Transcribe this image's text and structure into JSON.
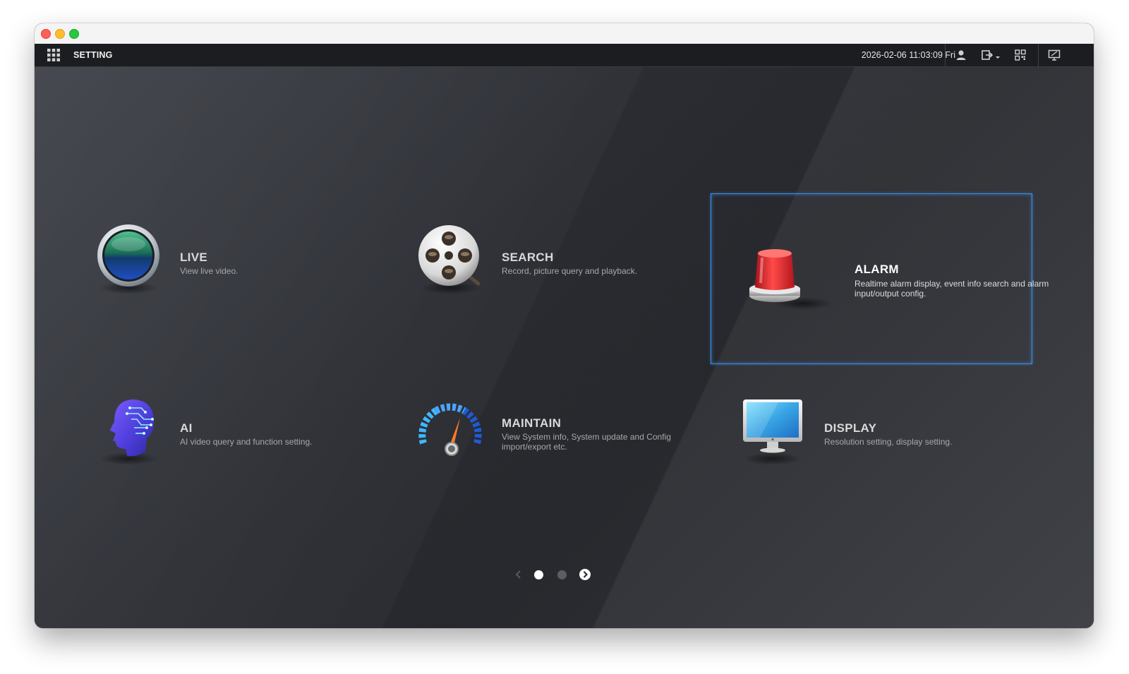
{
  "topbar": {
    "title": "SETTING",
    "datetime": "2026-02-06 11:03:09 Fri"
  },
  "tiles": [
    {
      "title": "LIVE",
      "desc": "View live video.",
      "icon": "live-lens-icon"
    },
    {
      "title": "SEARCH",
      "desc": "Record, picture query and playback.",
      "icon": "film-reel-search-icon"
    },
    {
      "title": "ALARM",
      "desc": "Realtime alarm display, event info search and alarm input/output config.",
      "icon": "alarm-siren-icon",
      "selected": true
    },
    {
      "title": "AI",
      "desc": "AI video query and function setting.",
      "icon": "ai-head-icon"
    },
    {
      "title": "MAINTAIN",
      "desc": "View System info, System update and Config import/export etc.",
      "icon": "gauge-icon"
    },
    {
      "title": "DISPLAY",
      "desc": "Resolution setting, display setting.",
      "icon": "monitor-icon"
    }
  ],
  "pager": {
    "current_page": 1,
    "total_pages": 2
  },
  "colors": {
    "selection_border": "#3d8de6",
    "topbar_bg": "#1c1d20",
    "content_bg": "#2f3136"
  }
}
